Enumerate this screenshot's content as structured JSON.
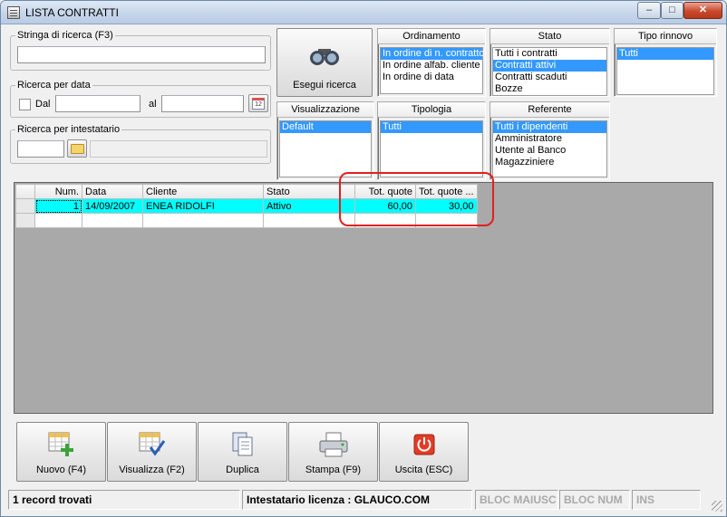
{
  "window": {
    "title": "LISTA CONTRATTI",
    "min_glyph": "–",
    "max_glyph": "□",
    "close_glyph": "✕"
  },
  "search": {
    "string_legend": "Stringa di ricerca (F3)",
    "string_value": ""
  },
  "date_search": {
    "legend": "Ricerca per data",
    "from_label": "Dal",
    "to_label": "al",
    "from_value": "",
    "to_value": "",
    "calendar_glyph": "12"
  },
  "holder_search": {
    "legend": "Ricerca per intestatario",
    "code_value": "",
    "name_value": ""
  },
  "search_button": {
    "label": "Esegui ricerca"
  },
  "ordering": {
    "header": "Ordinamento",
    "items": [
      "In ordine di n. contratto",
      "In ordine alfab. cliente",
      "In ordine di data"
    ],
    "selected": 0
  },
  "state": {
    "header": "Stato",
    "items": [
      "Tutti i contratti",
      "Contratti attivi",
      "Contratti scaduti",
      "Bozze"
    ],
    "selected": 1
  },
  "renewal": {
    "header": "Tipo rinnovo",
    "items": [
      "Tutti"
    ],
    "selected": 0
  },
  "view": {
    "header": "Visualizzazione",
    "items": [
      "Default"
    ],
    "selected": 0
  },
  "type": {
    "header": "Tipologia",
    "items": [
      "Tutti"
    ],
    "selected": 0
  },
  "referent": {
    "header": "Referente",
    "items": [
      "Tutti i dipendenti",
      "Amministratore",
      "Utente al Banco",
      "Magazziniere"
    ],
    "selected": 0
  },
  "grid": {
    "headers": {
      "num": "Num.",
      "date": "Data",
      "client": "Cliente",
      "state": "Stato",
      "tot_quote": "Tot. quote",
      "tot_quote2": "Tot. quote ..."
    },
    "rows": [
      {
        "num": "1",
        "date": "14/09/2007",
        "client": "ENEA RIDOLFI",
        "state": "Attivo",
        "tot_quote": "60,00",
        "tot_quote2": "30,00"
      }
    ]
  },
  "buttons": {
    "new": "Nuovo (F4)",
    "view": "Visualizza (F2)",
    "duplicate": "Duplica",
    "print": "Stampa (F9)",
    "exit": "Uscita (ESC)"
  },
  "status": {
    "records": "1 record trovati",
    "license": "Intestatario licenza : GLAUCO.COM",
    "caps": "BLOC MAIUSC",
    "num": "BLOC NUM",
    "ins": "INS"
  },
  "colors": {
    "selection": "#3399ff",
    "row_highlight": "#00ffff",
    "annotation": "#e02020",
    "grid_bg": "#a9a9a9"
  }
}
